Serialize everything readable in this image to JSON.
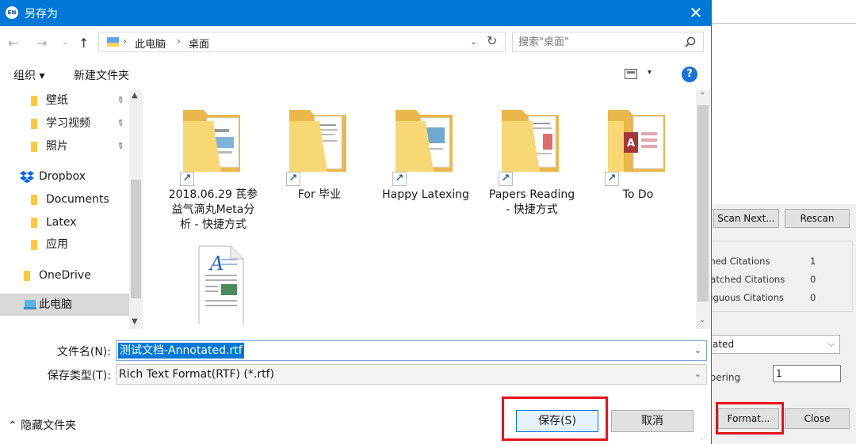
{
  "background_window": {
    "scan_next_label": "Scan Next...",
    "rescan_label": "Rescan",
    "stats": [
      {
        "label": "ched Citations",
        "count": "1"
      },
      {
        "label": "natched Citations",
        "count": "0"
      },
      {
        "label": "biguous Citations",
        "count": "0"
      }
    ],
    "style_select_value": "ated",
    "numbering_label": "nbering",
    "numbering_value": "1",
    "format_label": "Format...",
    "close_label": "Close"
  },
  "dialog": {
    "title": "另存为",
    "title_icon_text": "EN",
    "close_glyph": "✕",
    "nav": {
      "back": "←",
      "forward": "→",
      "recent": "⌄",
      "up": "↑"
    },
    "breadcrumb": [
      "此电脑",
      "桌面"
    ],
    "breadcrumb_sep": "›",
    "address_dropdown": "⌄",
    "refresh_glyph": "↻",
    "search_placeholder": "搜索\"桌面\"",
    "toolbar": {
      "organize": "组织 ▾",
      "new_folder": "新建文件夹",
      "view_dropdown": "▾",
      "help": "?"
    },
    "nav_items": [
      {
        "label": "壁纸",
        "pinned": true
      },
      {
        "label": "学习视频",
        "pinned": true
      },
      {
        "label": "照片",
        "pinned": true
      },
      {
        "label": "Dropbox",
        "pinned": false
      },
      {
        "label": "Documents",
        "pinned": false
      },
      {
        "label": "Latex",
        "pinned": false
      },
      {
        "label": "应用",
        "pinned": false
      },
      {
        "label": "OneDrive",
        "pinned": false
      },
      {
        "label": "此电脑",
        "pinned": false
      }
    ],
    "files": [
      {
        "name": "2018.06.29 芪参益气滴丸Meta分析 - 快捷方式",
        "kind": "folder-shortcut"
      },
      {
        "name": "For 毕业",
        "kind": "folder-shortcut"
      },
      {
        "name": "Happy Latexing",
        "kind": "folder-shortcut"
      },
      {
        "name": "Papers Reading - 快捷方式",
        "kind": "folder-shortcut"
      },
      {
        "name": "To Do",
        "kind": "folder-shortcut"
      },
      {
        "name": "",
        "kind": "document"
      }
    ],
    "file_name_label": "文件名(N):",
    "file_name_value": "测试文档-Annotated.rtf",
    "save_type_label": "保存类型(T):",
    "save_type_value": "Rich Text Format(RTF) (*.rtf)",
    "hide_folders_label": "⌃ 隐藏文件夹",
    "save_label": "保存(S)",
    "cancel_label": "取消"
  },
  "colors": {
    "titlebar": "#0078d7",
    "highlight_box": "#e8141b",
    "folder": "#ffc83d",
    "selection": "#0078d7"
  }
}
